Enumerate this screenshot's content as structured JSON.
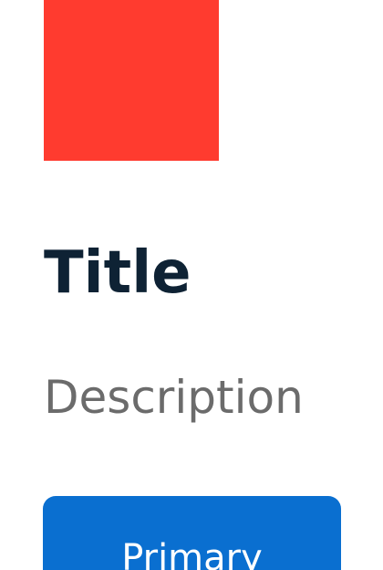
{
  "card": {
    "title": "Title",
    "description": "Description",
    "primary_button_label": "Primary"
  },
  "colors": {
    "image_placeholder": "#ff3b2f",
    "title_text": "#0e2234",
    "description_text": "#6b6b6b",
    "primary_button_bg": "#0a6fd0",
    "primary_button_text": "#ffffff"
  }
}
